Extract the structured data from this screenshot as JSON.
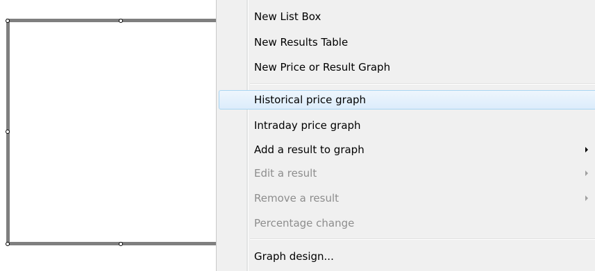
{
  "context_menu": {
    "groups": [
      {
        "items": [
          {
            "label": "New List Box",
            "enabled": true,
            "submenu": false
          },
          {
            "label": "New Results Table",
            "enabled": true,
            "submenu": false
          },
          {
            "label": "New Price or Result Graph",
            "enabled": true,
            "submenu": false
          }
        ]
      },
      {
        "items": [
          {
            "label": "Historical price graph",
            "enabled": true,
            "submenu": false,
            "highlighted": true
          },
          {
            "label": "Intraday price graph",
            "enabled": true,
            "submenu": false
          },
          {
            "label": "Add a result to graph",
            "enabled": true,
            "submenu": true
          },
          {
            "label": "Edit a result",
            "enabled": false,
            "submenu": true
          },
          {
            "label": "Remove a result",
            "enabled": false,
            "submenu": true
          },
          {
            "label": "Percentage change",
            "enabled": false,
            "submenu": false
          }
        ]
      },
      {
        "items": [
          {
            "label": "Graph design...",
            "enabled": true,
            "submenu": false
          }
        ]
      }
    ]
  },
  "colors": {
    "menu_background": "#f0f0f0",
    "highlight_border": "#a9d5f2",
    "disabled_text": "#8d8d8d",
    "frame_border": "#7f7f7f"
  }
}
